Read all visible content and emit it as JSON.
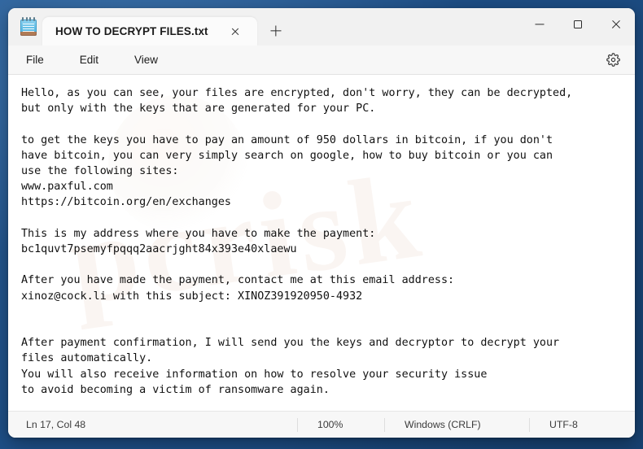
{
  "window": {
    "app_icon": "notepad-icon",
    "tab_title": "HOW TO DECRYPT FILES.txt",
    "close_tab_icon": "close-icon",
    "new_tab_icon": "plus-icon",
    "minimize_icon": "minimize-icon",
    "maximize_icon": "maximize-icon",
    "close_icon": "close-icon"
  },
  "menubar": {
    "items": [
      {
        "label": "File"
      },
      {
        "label": "Edit"
      },
      {
        "label": "View"
      }
    ],
    "settings_icon": "gear-icon"
  },
  "editor": {
    "content": "Hello, as you can see, your files are encrypted, don't worry, they can be decrypted,\nbut only with the keys that are generated for your PC.\n\nto get the keys you have to pay an amount of 950 dollars in bitcoin, if you don't\nhave bitcoin, you can very simply search on google, how to buy bitcoin or you can\nuse the following sites:\nwww.paxful.com\nhttps://bitcoin.org/en/exchanges\n\nThis is my address where you have to make the payment:\nbc1quvt7psemyfpqqq2aacrjght84x393e40xlaewu\n\nAfter you have made the payment, contact me at this email address:\nxinoz@cock.li with this subject: XINOZ391920950-4932\n\n\nAfter payment confirmation, I will send you the keys and decryptor to decrypt your\nfiles automatically.\nYou will also receive information on how to resolve your security issue\nto avoid becoming a victim of ransomware again.",
    "ransom_amount": "950 dollars",
    "payment_sites": [
      "www.paxful.com",
      "https://bitcoin.org/en/exchanges"
    ],
    "bitcoin_address": "bc1quvt7psemyfpqqq2aacrjght84x393e40xlaewu",
    "contact_email": "xinoz@cock.li",
    "email_subject": "XINOZ391920950-4932",
    "watermark": "pcrisk"
  },
  "statusbar": {
    "position": "Ln 17, Col 48",
    "zoom": "100%",
    "line_ending": "Windows (CRLF)",
    "encoding": "UTF-8"
  }
}
